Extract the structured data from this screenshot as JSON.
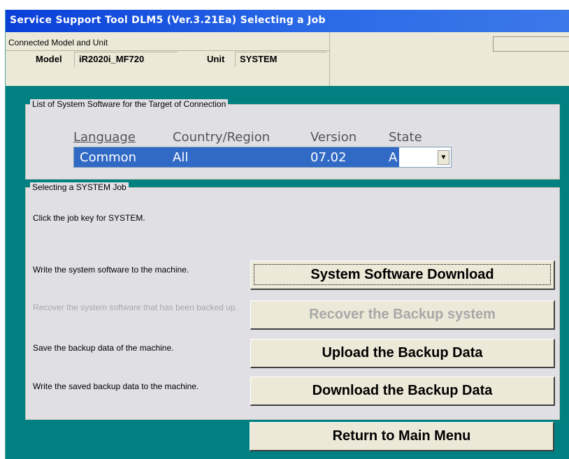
{
  "window": {
    "title": "Service Support Tool DLM5 (Ver.3.21Ea) Selecting a Job"
  },
  "connection": {
    "heading": "Connected Model and Unit",
    "model_label": "Model",
    "model_value": "iR2020i_MF720",
    "unit_label": "Unit",
    "unit_value": "SYSTEM"
  },
  "software_list": {
    "legend": "List of System Software for the Target of Connection",
    "columns": [
      "Language",
      "Country/Region",
      "Version",
      "State"
    ],
    "selected": {
      "language": "Common",
      "country": "All",
      "version": "07.02",
      "state": "A"
    },
    "dropdown_icon": "triangle-down"
  },
  "jobs": {
    "legend": "Selecting a SYSTEM Job",
    "instruction": "Click the job key for SYSTEM.",
    "items": [
      {
        "description": "Write the system software to the machine.",
        "button": "System Software Download",
        "enabled": true
      },
      {
        "description": "Recover the system software that has been backed up.",
        "button": "Recover the Backup system",
        "enabled": false
      },
      {
        "description": "Save the backup data of the machine.",
        "button": "Upload the Backup Data",
        "enabled": true
      },
      {
        "description": "Write the saved backup data to the machine.",
        "button": "Download the Backup Data",
        "enabled": true
      }
    ]
  },
  "footer": {
    "return_label": "Return to Main Menu"
  },
  "colors": {
    "title_bar": "#0a3fd8",
    "background": "#008080",
    "panel": "#e0dfe3",
    "selection": "#316ac5",
    "disabled_text": "#a8a8a8"
  }
}
